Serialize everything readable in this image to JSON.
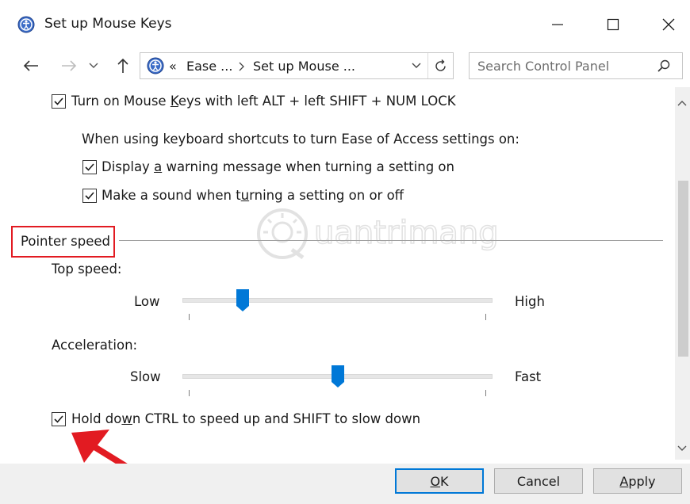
{
  "window": {
    "title": "Set up Mouse Keys",
    "controls": {
      "minimize": "minimize-icon",
      "maximize": "maximize-icon",
      "close": "close-icon"
    }
  },
  "nav": {
    "breadcrumb": [
      "Ease ...",
      "Set up Mouse ..."
    ],
    "breadcrumb_prefix": "«",
    "search_placeholder": "Search Control Panel"
  },
  "options": {
    "turn_on_pre": "Turn on Mouse ",
    "turn_on_key": "K",
    "turn_on_post": "eys with left ALT + left SHIFT + NUM LOCK",
    "turn_on_checked": true,
    "shortcut_heading": "When using keyboard shortcuts to turn Ease of Access settings on:",
    "warning_pre": "Display ",
    "warning_key": "a",
    "warning_post": " warning message when turning a setting on",
    "warning_checked": true,
    "sound_pre": "Make a sound when t",
    "sound_key": "u",
    "sound_post": "rning a setting on or off",
    "sound_checked": true
  },
  "pointer_speed": {
    "section_title": "Pointer speed",
    "top_speed_label": "Top speed:",
    "top_speed_low": "Low",
    "top_speed_high": "High",
    "top_speed_value": 0.18,
    "acceleration_label": "Acceleration:",
    "acceleration_low": "Slow",
    "acceleration_high": "Fast",
    "acceleration_value": 0.5,
    "hold_pre": "Hold do",
    "hold_key": "w",
    "hold_post": "n CTRL to speed up and SHIFT to slow down",
    "hold_checked": true
  },
  "buttons": {
    "ok_key": "O",
    "ok_rest": "K",
    "cancel": "Cancel",
    "apply_key": "A",
    "apply_rest": "pply"
  },
  "watermark": "Quantrimang",
  "colors": {
    "highlight": "#e21b22",
    "accent": "#0078d7",
    "arrow": "#e21b22"
  }
}
